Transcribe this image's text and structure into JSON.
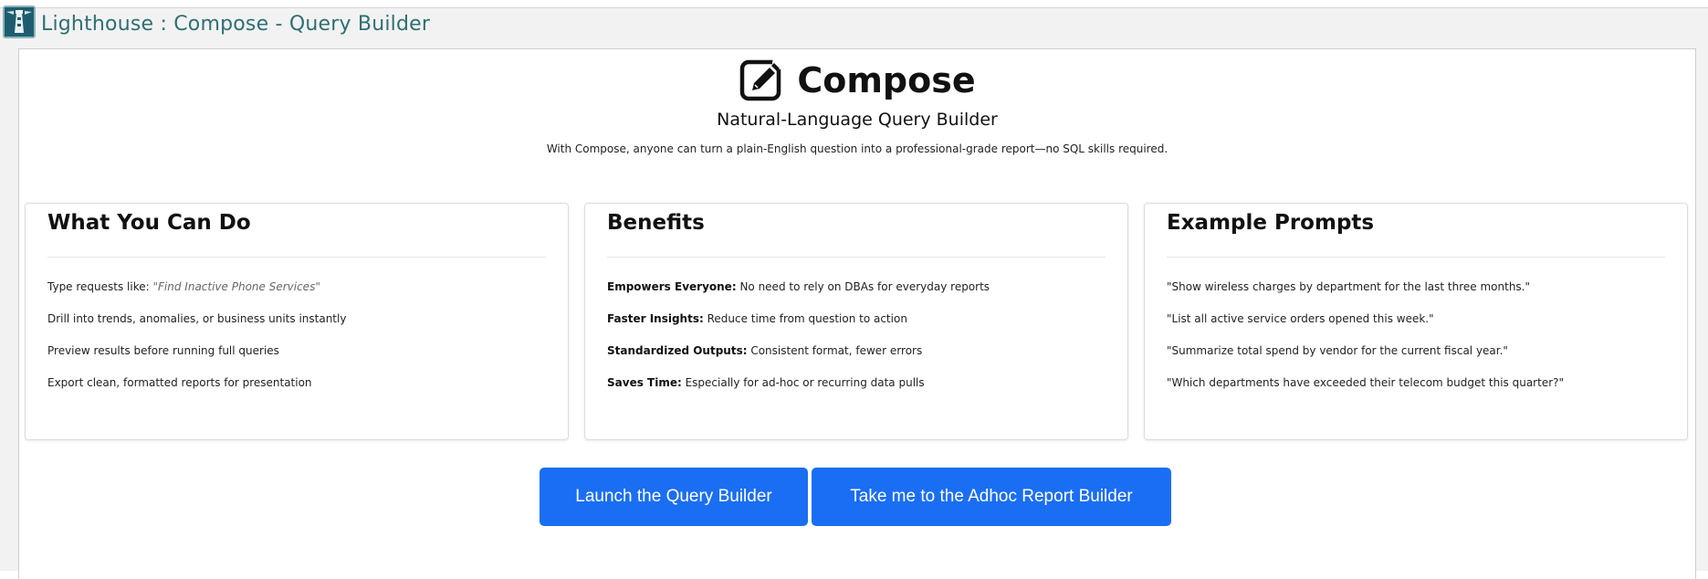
{
  "window": {
    "title": "Lighthouse : Compose - Query Builder",
    "icon": "lighthouse-icon"
  },
  "hero": {
    "icon": "edit-square-icon",
    "title": "Compose",
    "subtitle": "Natural-Language Query Builder",
    "description": "With Compose, anyone can turn a plain-English question into a professional-grade report—no SQL skills required."
  },
  "cards": {
    "what_you_can_do": {
      "title": "What You Can Do",
      "items": [
        {
          "prefix": "Type requests like: ",
          "example": "\"Find Inactive Phone Services\""
        },
        {
          "text": "Drill into trends, anomalies, or business units instantly"
        },
        {
          "text": "Preview results before running full queries"
        },
        {
          "text": "Export clean, formatted reports for presentation"
        }
      ]
    },
    "benefits": {
      "title": "Benefits",
      "items": [
        {
          "label": "Empowers Everyone:",
          "text": " No need to rely on DBAs for everyday reports"
        },
        {
          "label": "Faster Insights:",
          "text": " Reduce time from question to action"
        },
        {
          "label": "Standardized Outputs:",
          "text": " Consistent format, fewer errors"
        },
        {
          "label": "Saves Time:",
          "text": " Especially for ad-hoc or recurring data pulls"
        }
      ]
    },
    "example_prompts": {
      "title": "Example Prompts",
      "items": [
        "\"Show wireless charges by department for the last three months.\"",
        "\"List all active service orders opened this week.\"",
        "\"Summarize total spend by vendor for the current fiscal year.\"",
        "\"Which departments have exceeded their telecom budget this quarter?\""
      ]
    }
  },
  "actions": {
    "launch_label": "Launch the Query Builder",
    "adhoc_label": "Take me to the Adhoc Report Builder"
  },
  "colors": {
    "accent": "#1a6ef3",
    "title_teal": "#2e6f73"
  }
}
